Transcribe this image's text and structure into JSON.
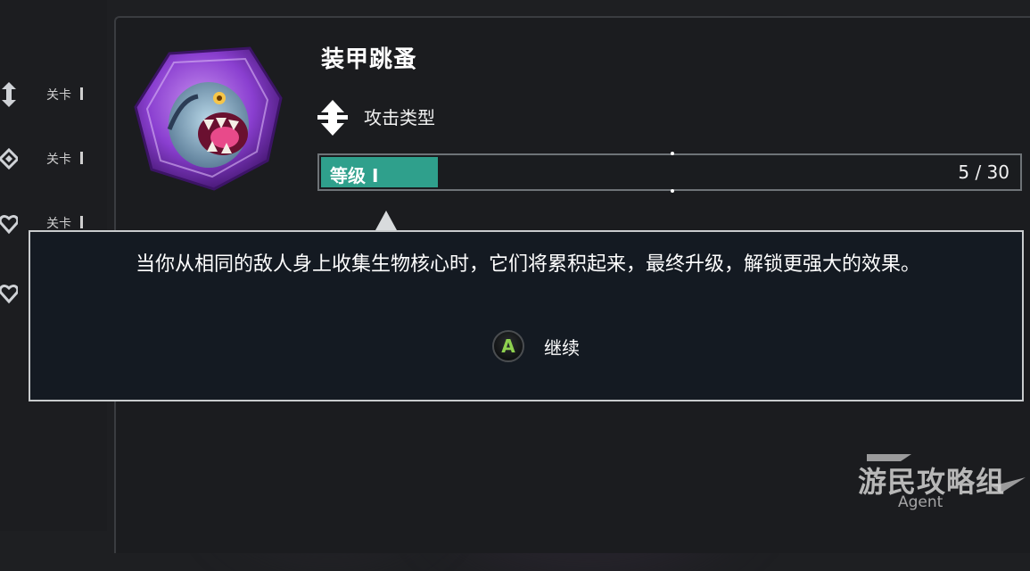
{
  "left_rail": {
    "items": [
      {
        "label": "关卡",
        "icon": "attack-arrow-icon"
      },
      {
        "label": "关卡",
        "icon": "diamond-icon"
      },
      {
        "label": "关卡",
        "icon": "heart-icon"
      },
      {
        "label": "",
        "icon": "heart-icon"
      }
    ]
  },
  "creature": {
    "name": "装甲跳蚤",
    "portrait_icon": "creature-portrait-icon",
    "type_icon": "attack-type-icon",
    "type_label": "攻击类型"
  },
  "progress": {
    "level_label": "等级 I",
    "count_text": "5 / 30",
    "current": 5,
    "total": 30,
    "fill_color": "#2fa08c"
  },
  "dialog": {
    "message": "当你从相同的敌人身上收集生物核心时，它们将累积起来，最终升级，解锁更强大的效果。",
    "button_glyph": "A",
    "button_label": "继续",
    "button_glyph_color": "#8fd14f"
  },
  "watermark": {
    "main": "游民攻略组",
    "sub": "Agent"
  }
}
